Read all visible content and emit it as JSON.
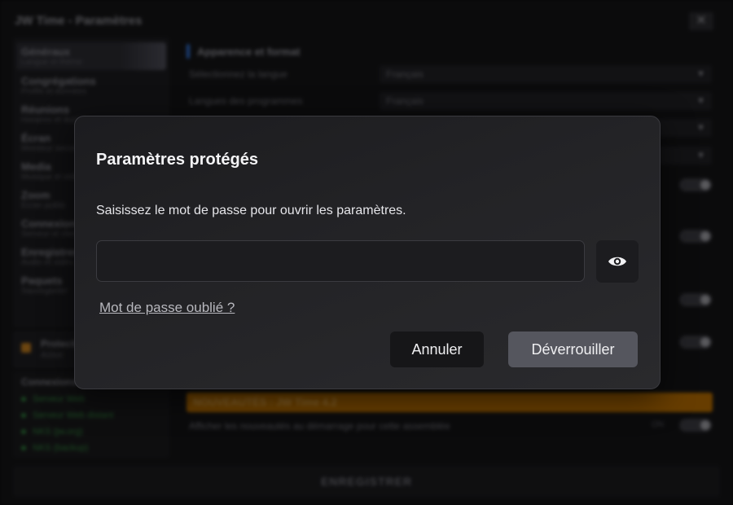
{
  "window": {
    "title": "JW Time - Paramètres",
    "close_label": "✕"
  },
  "sidebar": {
    "items": [
      {
        "title": "Généraux",
        "subtitle": "Langue et thème"
      },
      {
        "title": "Congrégations",
        "subtitle": "Profils et données"
      },
      {
        "title": "Réunions",
        "subtitle": "Horaires et durées"
      },
      {
        "title": "Écran",
        "subtitle": "Moniteur secondaire"
      },
      {
        "title": "Media",
        "subtitle": "Musique et vidéos"
      },
      {
        "title": "Zoom",
        "subtitle": "Écran public"
      },
      {
        "title": "Connexions",
        "subtitle": "Serveur et clients"
      },
      {
        "title": "Enregistrement",
        "subtitle": "Audio et vidéo"
      },
      {
        "title": "Paquets",
        "subtitle": "Sauvegarder"
      }
    ],
    "protection": {
      "title": "Protection",
      "status": "Active"
    },
    "connections": {
      "title": "Connexions",
      "items": [
        "Serveur Web",
        "Serveur Web distant",
        "NKS (jw.org)",
        "NKS (backup)"
      ]
    }
  },
  "content": {
    "section_title": "Apparence et format",
    "rows": [
      {
        "label": "Sélectionnez la langue",
        "value": "Français"
      },
      {
        "label": "Langues des programmes",
        "value": "Français"
      }
    ],
    "news_banner": "NOUVEAUTÉS : JW Time 4.2",
    "news_row_label": "Afficher les nouveautés au démarrage pour cette assemblée",
    "news_toggle_state": "ON"
  },
  "save_label": "ENREGISTRER",
  "modal": {
    "title": "Paramètres protégés",
    "description": "Saisissez le mot de passe pour ouvrir les paramètres.",
    "password_value": "",
    "forgot_link": "Mot de passe oublié ?",
    "cancel_label": "Annuler",
    "unlock_label": "Déverrouiller",
    "eye_icon": "eye-icon"
  },
  "colors": {
    "accent_blue": "#2f6fd0",
    "news_orange": "#b26a00",
    "status_green": "#2e7d3a",
    "unlock_button": "#55565e"
  }
}
